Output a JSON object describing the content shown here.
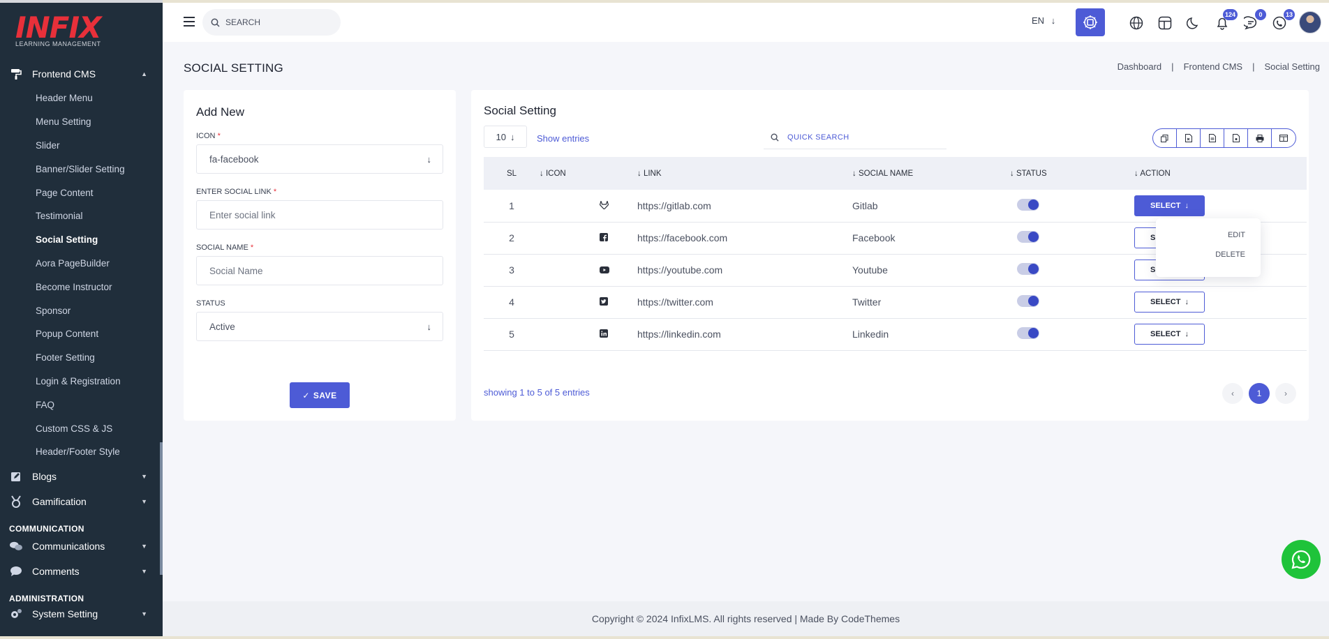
{
  "brand": {
    "logo": "INFIX",
    "tagline": "LEARNING MANAGEMENT"
  },
  "sidebar": {
    "group_frontend": "Frontend CMS",
    "items": [
      "Header Menu",
      "Menu Setting",
      "Slider",
      "Banner/Slider Setting",
      "Page Content",
      "Testimonial",
      "Social Setting",
      "Aora PageBuilder",
      "Become Instructor",
      "Sponsor",
      "Popup Content",
      "Footer Setting",
      "Login & Registration",
      "FAQ",
      "Custom CSS & JS",
      "Header/Footer Style"
    ],
    "active_item": "Social Setting",
    "group_blogs": "Blogs",
    "group_gamification": "Gamification",
    "section_communication": "COMMUNICATION",
    "group_communications": "Communications",
    "group_comments": "Comments",
    "section_administration": "ADMINISTRATION",
    "group_system": "System Setting"
  },
  "topbar": {
    "search_placeholder": "SEARCH",
    "language": "EN",
    "notifications_count": "124",
    "messages_count": "0",
    "calls_count": "13"
  },
  "page": {
    "title": "SOCIAL SETTING",
    "breadcrumb": [
      "Dashboard",
      "Frontend CMS",
      "Social Setting"
    ]
  },
  "form": {
    "title": "Add New",
    "icon_label": "ICON",
    "icon_value": "fa-facebook",
    "link_label": "ENTER SOCIAL LINK",
    "link_placeholder": "Enter social link",
    "name_label": "SOCIAL NAME",
    "name_placeholder": "Social Name",
    "status_label": "STATUS",
    "status_value": "Active",
    "save_label": "SAVE",
    "required_mark": "*"
  },
  "table": {
    "title": "Social Setting",
    "page_size": "10",
    "show_entries": "Show entries",
    "quick_search": "QUICK SEARCH",
    "columns": [
      "SL",
      "ICON",
      "LINK",
      "SOCIAL NAME",
      "STATUS",
      "ACTION"
    ],
    "rows": [
      {
        "sl": "1",
        "icon": "gitlab-icon",
        "link": "https://gitlab.com",
        "name": "Gitlab",
        "status": true
      },
      {
        "sl": "2",
        "icon": "facebook-icon",
        "link": "https://facebook.com",
        "name": "Facebook",
        "status": true
      },
      {
        "sl": "3",
        "icon": "youtube-icon",
        "link": "https://youtube.com",
        "name": "Youtube",
        "status": true
      },
      {
        "sl": "4",
        "icon": "twitter-icon",
        "link": "https://twitter.com",
        "name": "Twitter",
        "status": true
      },
      {
        "sl": "5",
        "icon": "linkedin-icon",
        "link": "https://linkedin.com",
        "name": "Linkedin",
        "status": true
      }
    ],
    "select_label": "SELECT",
    "dropdown_items": [
      "EDIT",
      "DELETE"
    ],
    "entries_info": "showing 1 to 5 of 5 entries",
    "current_page": "1"
  },
  "footer": {
    "text": "Copyright © 2024 InfixLMS. All rights reserved | Made By CodeThemes"
  },
  "colors": {
    "accent": "#4d5bd6",
    "sidebar": "#202e3b",
    "brand_red": "#e8303a",
    "whatsapp": "#1fc33a"
  }
}
